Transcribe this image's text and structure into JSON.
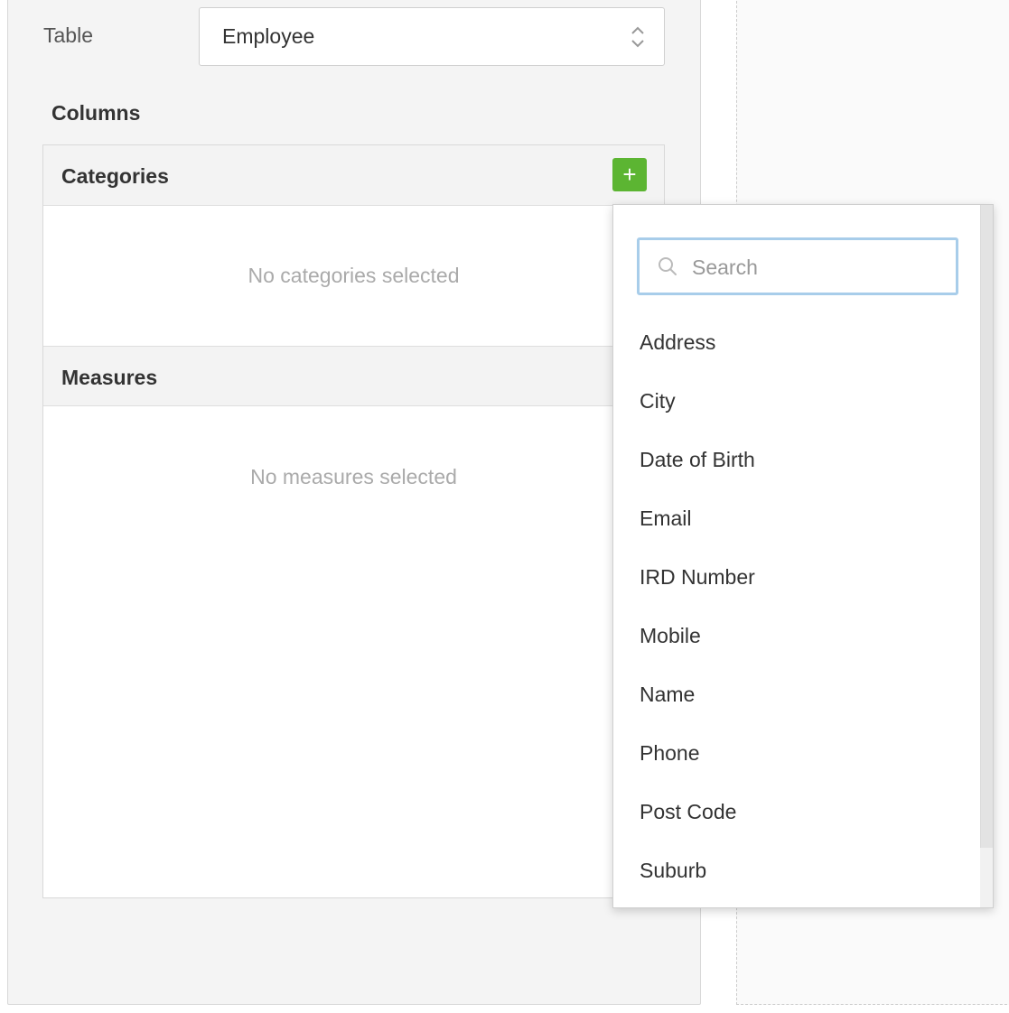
{
  "form": {
    "table_label": "Table",
    "table_select": {
      "value": "Employee"
    },
    "columns_heading": "Columns"
  },
  "categories": {
    "title": "Categories",
    "add_label": "+",
    "empty_text": "No categories selected"
  },
  "measures": {
    "title": "Measures",
    "empty_text": "No measures selected"
  },
  "dropdown": {
    "search_placeholder": "Search",
    "options": [
      "Address",
      "City",
      "Date of Birth",
      "Email",
      "IRD Number",
      "Mobile",
      "Name",
      "Phone",
      "Post Code",
      "Suburb"
    ]
  },
  "colors": {
    "accent_green": "#5cb532",
    "search_focus_border": "#a8cdea",
    "panel_background": "#f4f4f4"
  },
  "icons": {
    "select": "chevron-up-down-icon",
    "search": "search-icon",
    "add": "plus-icon"
  }
}
